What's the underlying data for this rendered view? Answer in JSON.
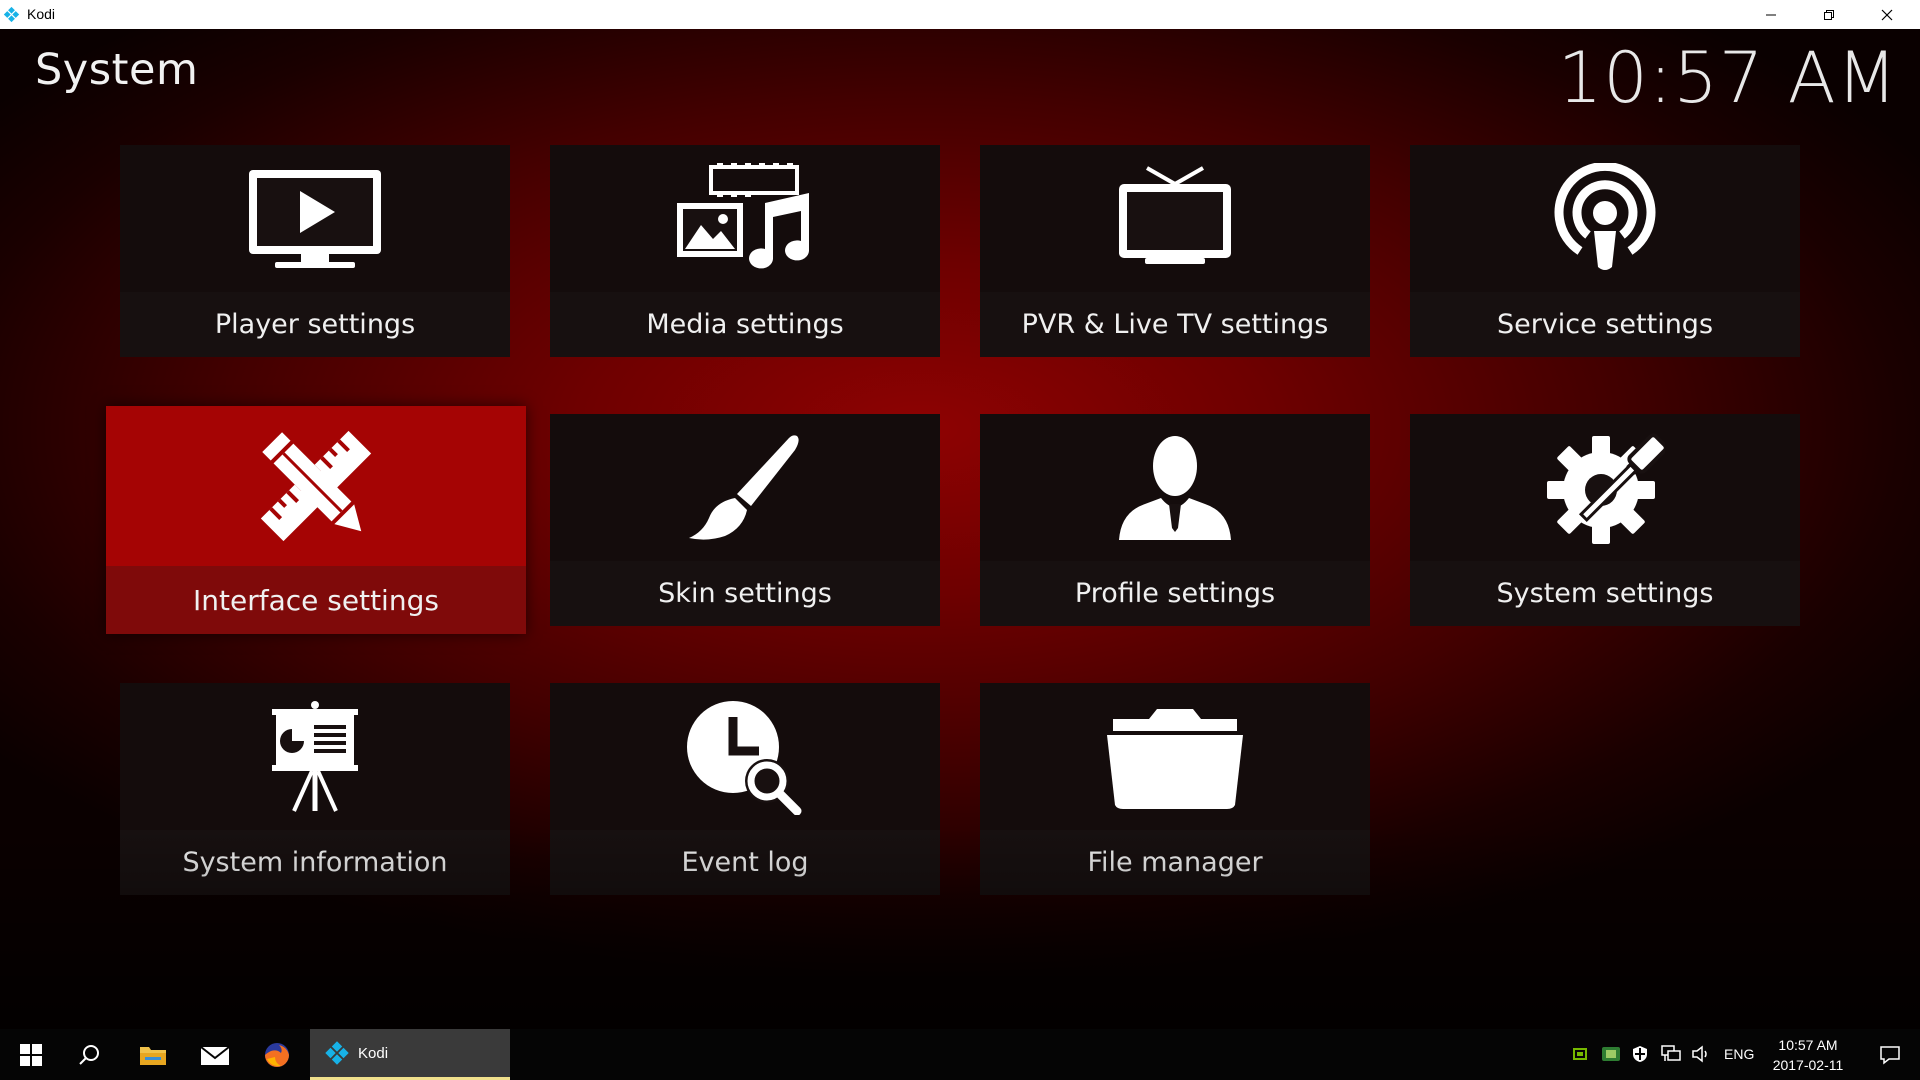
{
  "window": {
    "title": "Kodi",
    "controls": [
      "minimize",
      "restore",
      "close"
    ]
  },
  "page": {
    "title": "System",
    "clock": "10:57 AM"
  },
  "tiles": [
    {
      "label": "Player settings",
      "icon": "monitor-play-icon",
      "focused": false
    },
    {
      "label": "Media settings",
      "icon": "media-filmstrip-picture-music-icon",
      "focused": false
    },
    {
      "label": "PVR & Live TV settings",
      "icon": "tv-antenna-icon",
      "focused": false
    },
    {
      "label": "Service settings",
      "icon": "podcast-broadcast-icon",
      "focused": false
    },
    {
      "label": "Interface settings",
      "icon": "pencil-ruler-icon",
      "focused": true
    },
    {
      "label": "Skin settings",
      "icon": "paintbrush-icon",
      "focused": false
    },
    {
      "label": "Profile settings",
      "icon": "user-profile-icon",
      "focused": false
    },
    {
      "label": "System settings",
      "icon": "gear-screwdriver-icon",
      "focused": false
    },
    {
      "label": "System information",
      "icon": "presentation-easel-icon",
      "focused": false
    },
    {
      "label": "Event log",
      "icon": "clock-search-icon",
      "focused": false
    },
    {
      "label": "File manager",
      "icon": "folder-icon",
      "focused": false
    }
  ],
  "colors": {
    "accent_focus": "#a00000",
    "background_glow": "#8e0202",
    "tile_bg": "#1c1010",
    "text": "#f0f0f0"
  },
  "taskbar": {
    "pinned": [
      "windows-start-icon",
      "search-icon",
      "file-explorer-icon",
      "mail-icon",
      "firefox-icon"
    ],
    "active_app": {
      "label": "Kodi",
      "icon": "kodi-icon"
    },
    "tray": {
      "language": "ENG",
      "time": "10:57 AM",
      "date": "2017-02-11"
    }
  }
}
